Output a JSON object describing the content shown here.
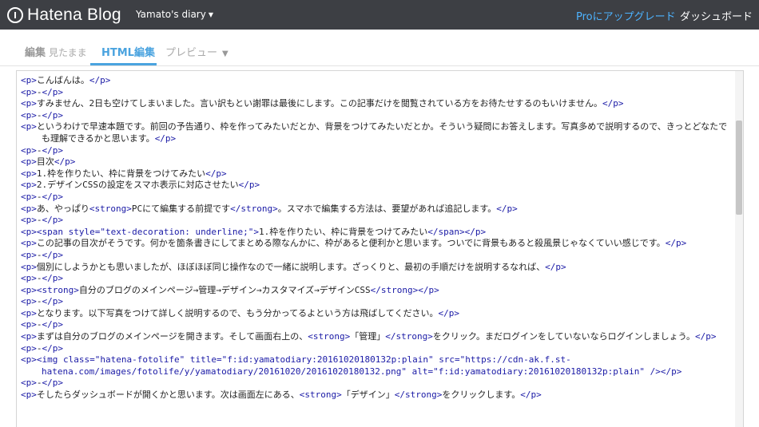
{
  "header": {
    "logo_text": "Hatena Blog",
    "blog_name": "Yamato's diary",
    "pro_link": "Proにアップグレード",
    "dashboard_link": "ダッシュボード"
  },
  "tabs": {
    "edit_label": "編集",
    "edit_sub": "見たまま",
    "html_label": "HTML編集",
    "preview_label": "プレビュー"
  },
  "editor": {
    "lines": [
      "<p>こんばんは。</p>",
      "<p>-</p>",
      "<p>すみません、2日も空けてしまいました。言い訳もとい謝罪は最後にします。この記事だけを閲覧されている方をお待たせするのもいけません。</p>",
      "<p>-</p>",
      "<p>というわけで早速本題です。前回の予告通り、枠を作ってみたいだとか、背景をつけてみたいだとか。そういう疑問にお答えします。写真多めで説明するので、きっとどなたでも理解できるかと思います。</p>",
      "<p>-</p>",
      "<p>目次</p>",
      "<p>1.枠を作りたい、枠に背景をつけてみたい</p>",
      "<p>2.デザインCSSの設定をスマホ表示に対応させたい</p>",
      "<p>-</p>",
      "<p>あ、やっぱり<strong>PCにて編集する前提です</strong>。スマホで編集する方法は、要望があれば追記します。</p>",
      "<p>-</p>",
      "<p><span style=\"text-decoration: underline;\">1.枠を作りたい、枠に背景をつけてみたい</span></p>",
      "<p>この記事の目次がそうです。何かを箇条書きにしてまとめる際なんかに、枠があると便利かと思います。ついでに背景もあると殺風景じゃなくていい感じです。</p>",
      "<p>-</p>",
      "<p>個別にしようかとも思いましたが、ほぼほぼ同じ操作なので一緒に説明します。ざっくりと、最初の手順だけを説明するなれば、</p>",
      "<p>-</p>",
      "<p><strong>自分のブログのメインページ→管理→デザイン→カスタマイズ→デザインCSS</strong></p>",
      "<p>-</p>",
      "<p>となります。以下写真をつけて詳しく説明するので、もう分かってるよという方は飛ばしてください。</p>",
      "<p>-</p>",
      "<p>まずは自分のブログのメインページを開きます。そして画面右上の、<strong>「管理」</strong>をクリック。まだログインをしていないならログインしましょう。</p>",
      "<p>-</p>",
      "<p><img class=\"hatena-fotolife\" title=\"f:id:yamatodiary:20161020180132p:plain\" src=\"https://cdn-ak.f.st-hatena.com/images/fotolife/y/yamatodiary/20161020/20161020180132.png\" alt=\"f:id:yamatodiary:20161020180132p:plain\" /></p>",
      "<p>-</p>",
      "<p>そしたらダッシュボードが開くかと思います。次は画面左にある、<strong>「デザイン」</strong>をクリックします。</p>"
    ]
  },
  "colors": {
    "topbar": "#3d3f44",
    "accent": "#4aa3df",
    "tag": "#1a1aa6",
    "pro": "#4db3ff"
  }
}
